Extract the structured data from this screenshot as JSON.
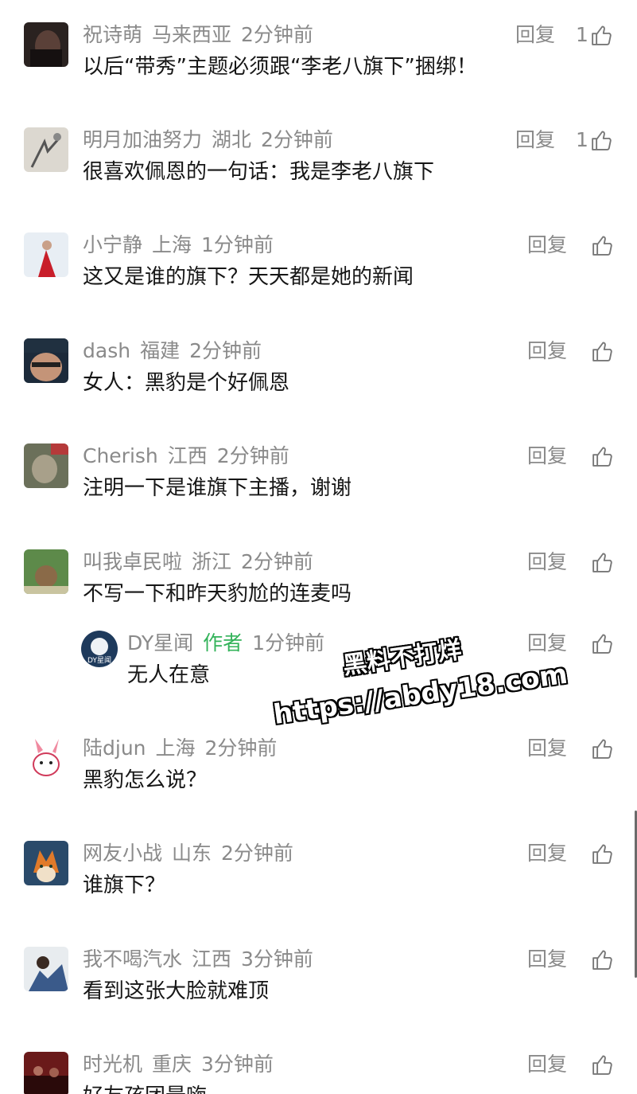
{
  "ui": {
    "reply_label": "回复",
    "author_tag": "作者"
  },
  "comments": [
    {
      "name": "祝诗萌",
      "location": "马来西亚",
      "time": "2分钟前",
      "text": "以后“带秀”主题必须跟“李老八旗下”捆绑！",
      "likes": "1"
    },
    {
      "name": "明月加油努力",
      "location": "湖北",
      "time": "2分钟前",
      "text": "很喜欢佩恩的一句话：我是李老八旗下",
      "likes": "1"
    },
    {
      "name": "小宁静",
      "location": "上海",
      "time": "1分钟前",
      "text": "这又是谁的旗下？天天都是她的新闻",
      "likes": ""
    },
    {
      "name": "dash",
      "location": "福建",
      "time": "2分钟前",
      "text": "女人：黑豹是个好佩恩",
      "likes": ""
    },
    {
      "name": "Cherish",
      "location": "江西",
      "time": "2分钟前",
      "text": "注明一下是谁旗下主播，谢谢",
      "likes": ""
    },
    {
      "name": "叫我卓民啦",
      "location": "浙江",
      "time": "2分钟前",
      "text": "不写一下和昨天豹尬的连麦吗",
      "likes": ""
    },
    {
      "name": "陆djun",
      "location": "上海",
      "time": "2分钟前",
      "text": "黑豹怎么说？",
      "likes": ""
    },
    {
      "name": "网友小战",
      "location": "山东",
      "time": "2分钟前",
      "text": "谁旗下？",
      "likes": ""
    },
    {
      "name": "我不喝汽水",
      "location": "江西",
      "time": "3分钟前",
      "text": "看到这张大脸就难顶",
      "likes": ""
    },
    {
      "name": "时光机",
      "location": "重庆",
      "time": "3分钟前",
      "text": "好友孩团最嗨",
      "likes": ""
    }
  ],
  "reply": {
    "name": "DY星闻",
    "time": "1分钟前",
    "text": "无人在意",
    "avatar_text": "DY星闻",
    "likes": ""
  },
  "watermark": {
    "line1": "黑料不打烊",
    "line2": "https://abdy18.com"
  },
  "colors": {
    "meta_gray": "#8a8a8a",
    "author_green": "#33b35a",
    "text": "#161616"
  }
}
